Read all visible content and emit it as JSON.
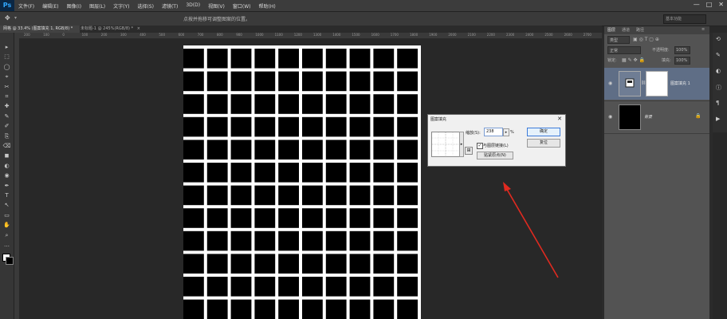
{
  "app": {
    "logo": "Ps"
  },
  "menu": [
    "文件(F)",
    "编辑(E)",
    "图像(I)",
    "图层(L)",
    "文字(Y)",
    "选择(S)",
    "滤镜(T)",
    "3D(D)",
    "视图(V)",
    "窗口(W)",
    "帮助(H)"
  ],
  "window_controls": {
    "minimize": "—",
    "restore": "□",
    "close": "✕"
  },
  "options_bar": {
    "tool_icon": "move-icon",
    "hint": "点按并拖移可调整图案的位置。",
    "workspace_label": "基本功能"
  },
  "tabs": [
    {
      "label": "网格 @ 33.4% (图案填充 1, RGB/8) *",
      "close": "×"
    },
    {
      "label": "未标题-1 @ 245%(RGB/8) *",
      "close": "×"
    }
  ],
  "ruler_ticks": [
    "200",
    "100",
    "0",
    "100",
    "200",
    "300",
    "400",
    "500",
    "600",
    "700",
    "800",
    "900",
    "1000",
    "1100",
    "1200",
    "1300",
    "1400",
    "1500",
    "1600",
    "1700",
    "1800",
    "1900",
    "2000",
    "2100",
    "2200",
    "2300",
    "2400",
    "2500",
    "2600",
    "2700"
  ],
  "tools": [
    "▸",
    "⬚",
    "◯",
    "⌖",
    "✂",
    "⌗",
    "✚",
    "✎",
    "✐",
    "⎘",
    "⌫",
    "◼",
    "◐",
    "◉",
    "✒",
    "T",
    "↖",
    "▭",
    "✋",
    "⌕",
    "…"
  ],
  "canvas": {
    "pattern": "grid",
    "fill_color": "#000000",
    "line_color": "#ffffff",
    "columns": 10,
    "rows": 12
  },
  "dialog": {
    "title": "图案填充",
    "close": "✕",
    "scale_label": "缩放(S):",
    "scale_value": "238",
    "scale_unit": "%",
    "snap_checked": true,
    "snap_label": "与图层链接(L)",
    "origin_button": "贴紧原点(N)",
    "ok_button": "确定",
    "reset_button": "复位",
    "new_preset_icon": "⊞"
  },
  "layers_panel": {
    "tabs": [
      "图层",
      "通道",
      "路径"
    ],
    "kind_label": "类型",
    "blend_mode": "正常",
    "opacity_label": "不透明度:",
    "opacity_value": "100%",
    "lock_label": "锁定:",
    "fill_label": "填充:",
    "fill_value": "100%",
    "layers": [
      {
        "name": "图案填充 1",
        "visible": true,
        "selected": true
      },
      {
        "name": "背景",
        "visible": true,
        "locked": true
      }
    ]
  },
  "annotation": {
    "arrow_color": "#e02a20"
  }
}
